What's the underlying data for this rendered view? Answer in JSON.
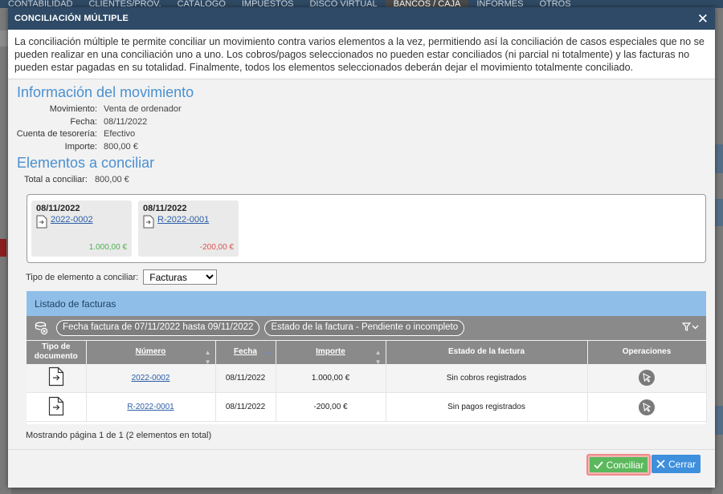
{
  "app_nav": {
    "items": [
      "CONTABILIDAD",
      "CLIENTES/PROV.",
      "CATÁLOGO",
      "IMPUESTOS",
      "DISCO VIRTUAL",
      "BANCOS / CAJA",
      "INFORMES",
      "OTROS"
    ]
  },
  "modal": {
    "title": "CONCILIACIÓN MÚLTIPLE",
    "close_glyph": "✕",
    "intro": "La conciliación múltiple te permite conciliar un movimiento contra varios elementos a la vez, permitiendo así la conciliación de casos especiales que no se pueden realizar en una conciliación uno a uno. Los cobros/pagos seleccionados no pueden estar conciliados (ni parcial ni totalmente) y las facturas no pueden estar pagadas en su totalidad. Finalmente, todos los elementos seleccionados deberán dejar el movimiento totalmente conciliado."
  },
  "movimiento": {
    "heading": "Información del movimiento",
    "fields": [
      {
        "label": "Movimiento:",
        "value": "Venta de ordenador"
      },
      {
        "label": "Fecha:",
        "value": "08/11/2022"
      },
      {
        "label": "Cuenta de tesorería:",
        "value": "Efectivo"
      },
      {
        "label": "Importe:",
        "value": "800,00 €"
      }
    ]
  },
  "elementos": {
    "heading": "Elementos a conciliar",
    "total_label": "Total a conciliar:",
    "total_value": "800,00 €",
    "cards": [
      {
        "date": "08/11/2022",
        "doc": "2022-0002",
        "amount": "1.000,00 €",
        "sign": "pos"
      },
      {
        "date": "08/11/2022",
        "doc": "R-2022-0001",
        "amount": "-200,00 €",
        "sign": "neg"
      }
    ],
    "type_label": "Tipo de elemento a conciliar:",
    "type_selected": "Facturas"
  },
  "listado": {
    "title": "Listado de facturas",
    "filters": [
      "Fecha factura de 07/11/2022 hasta 09/11/2022",
      "Estado de la factura - Pendiente o incompleto"
    ],
    "columns": [
      "Tipo de documento",
      "Número",
      "Fecha",
      "Importe",
      "Estado de la factura",
      "Operaciones"
    ],
    "rows": [
      {
        "numero": "2022-0002",
        "fecha": "08/11/2022",
        "importe": "1.000,00 €",
        "sign": "pos",
        "estado": "Sin cobros registrados"
      },
      {
        "numero": "R-2022-0001",
        "fecha": "08/11/2022",
        "importe": "-200,00 €",
        "sign": "neg",
        "estado": "Sin pagos registrados"
      }
    ],
    "pager": "Mostrando página 1 de 1 (2 elementos en total)"
  },
  "buttons": {
    "conciliar": "Conciliar",
    "cerrar": "Cerrar"
  },
  "colors": {
    "header": "#2e4a66",
    "heading_blue": "#4a90d0",
    "positive": "#4caf50",
    "negative": "#d9534f",
    "conciliar_bg": "#5cb85c",
    "cerrar_bg": "#3e8fdc"
  }
}
